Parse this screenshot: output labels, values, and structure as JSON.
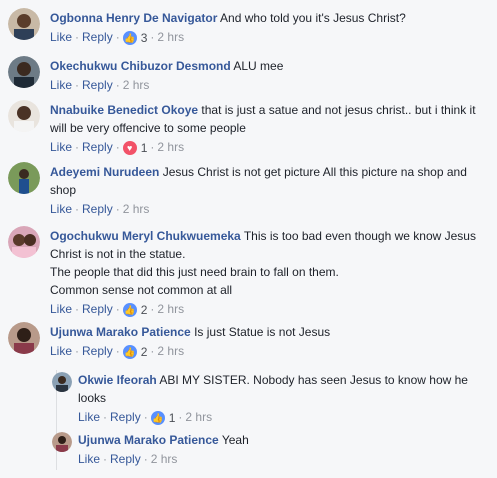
{
  "actions": {
    "like": "Like",
    "reply": "Reply",
    "sep": "·"
  },
  "colors": {
    "link": "#365899",
    "like_badge": "#5890ff",
    "love_badge": "#f25268"
  },
  "comments": [
    {
      "name": "Ogbonna Henry De Navigator",
      "text": "And who told you it's Jesus Christ?",
      "reaction": "like-icon",
      "count": "3",
      "time": "2 hrs"
    },
    {
      "name": "Okechukwu Chibuzor Desmond",
      "text": "ALU mee",
      "time": "2 hrs"
    },
    {
      "name": "Nnabuike Benedict Okoye",
      "text": "that is just a satue and not jesus christ.. but i think it will be very offencive to some people",
      "reaction": "heart-icon",
      "count": "1",
      "time": "2 hrs"
    },
    {
      "name": "Adeyemi Nurudeen",
      "text": "Jesus Christ is not get picture All this picture na shop and shop",
      "time": "2 hrs"
    },
    {
      "name": "Ogochukwu Meryl Chukwuemeka",
      "text": "This is too bad even though we know Jesus Christ is not in the statue.",
      "line2": "The people that did this just need brain to fall on them.",
      "line3": "Common sense not common at all",
      "reaction": "like-icon",
      "count": "2",
      "time": "2 hrs"
    },
    {
      "name": "Ujunwa Marako Patience",
      "text": "Is just Statue is not Jesus",
      "reaction": "like-icon",
      "count": "2",
      "time": "2 hrs"
    }
  ],
  "replies": [
    {
      "name": "Okwie Ifeorah",
      "text": "ABI MY SISTER. Nobody has seen Jesus to know how he looks",
      "reaction": "like-icon",
      "count": "1",
      "time": "2 hrs"
    },
    {
      "name": "Ujunwa Marako Patience",
      "text": "Yeah",
      "time": "2 hrs"
    }
  ]
}
